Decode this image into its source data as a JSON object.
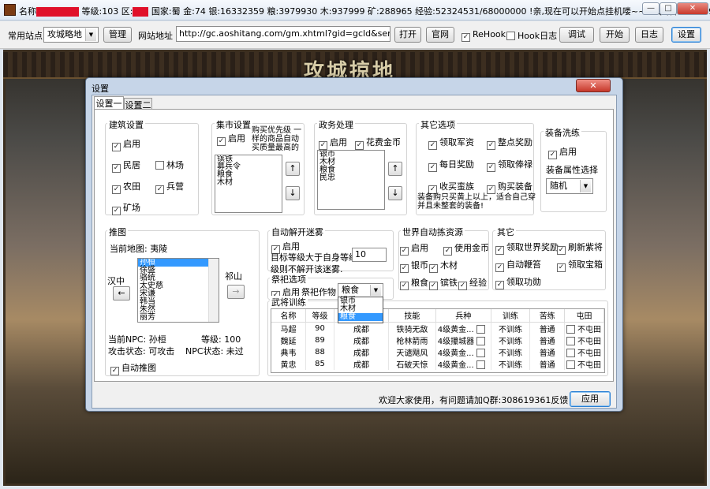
{
  "window": {
    "name_label": "名称",
    "level": "等级:103",
    "zone_label": "区:",
    "country": "国家:蜀",
    "gold": "金:74",
    "silver": "银:16332359",
    "food": "粮:3979930",
    "wood": "木:937999",
    "ore": "矿:288965",
    "exp": "经验:52324531/68000000",
    "message": "!亲,现在可以开始点挂机喽~~~",
    "qq": "QQ群:308619361",
    "min": "—",
    "max": "□",
    "close": "✕"
  },
  "toolbar": {
    "site_label": "常用站点",
    "site_value": "攻城略地",
    "manage": "管理",
    "url_label": "网站地址",
    "url": "http://gc.aoshitang.com/gm.xhtml?gid=gcld&server=113",
    "open": "打开",
    "official": "官网",
    "rehook": "ReHook",
    "hooklog": "Hook日志",
    "debug": "调试",
    "start": "开始",
    "log": "日志",
    "settings": "设置"
  },
  "game": {
    "title": "攻城掠地"
  },
  "dialog": {
    "title": "设置",
    "close": "✕",
    "tabs": [
      "设置一",
      "设置二"
    ],
    "build": {
      "title": "建筑设置",
      "enable": "启用",
      "items": [
        "民居",
        "林场",
        "农田",
        "兵营",
        "矿场"
      ]
    },
    "market": {
      "title": "集市设置",
      "enable": "启用",
      "hint1": "购买优先级 一",
      "hint2": "样的商品自动",
      "hint3": "买质量最高的",
      "items": [
        "镔铁",
        "募兵令",
        "粮食",
        "木材"
      ],
      "up": "↑",
      "down": "↓"
    },
    "affairs": {
      "title": "政务处理",
      "enable": "启用",
      "spend": "花费金币",
      "items": [
        "银币",
        "木材",
        "粮食",
        "民忠"
      ],
      "up": "↑",
      "down": "↓"
    },
    "other": {
      "title": "其它选项",
      "items": [
        "领取军资",
        "整点奖励",
        "每日奖励",
        "领取俸禄",
        "收买蛮族",
        "购买装备"
      ],
      "note1": "装备购只买黄上以上，适合自己穿",
      "note2": "并且未整套的装备!"
    },
    "equip": {
      "title": "装备洗练",
      "enable": "启用",
      "attr_label": "装备属性选择",
      "attr_value": "随机"
    },
    "push": {
      "title": "推图",
      "current_map": "当前地图: 夷陵",
      "left": "汉中",
      "right": "祁山",
      "prev": "←",
      "next": "→",
      "npcs": [
        "孙桓",
        "徐盛",
        "骆统",
        "太史慈",
        "宋谦",
        "韩当",
        "朱然",
        "丽芳"
      ],
      "npc_label": "当前NPC:",
      "npc_value": "孙桓",
      "lvl_label": "等级:",
      "lvl_value": "100",
      "atk_label": "攻击状态:",
      "atk_value": "可攻击",
      "npcst_label": "NPC状态:",
      "npcst_value": "未过",
      "auto": "自动推图"
    },
    "fog": {
      "title": "自动解开迷雾",
      "enable": "启用",
      "target_label": "目标等级大于自身等级",
      "target_value": "10",
      "hint": "级则不解开该迷雾."
    },
    "sacrifice": {
      "title": "祭祀选项",
      "enable": "启用",
      "crop_label": "祭祀作物",
      "crop_value": "粮食",
      "options": [
        "银币",
        "木材",
        "粮食"
      ]
    },
    "world": {
      "title": "世界自动拣资源",
      "items": [
        "启用",
        "使用金币",
        "银币",
        "木材",
        "粮食",
        "镔铁",
        "经验"
      ]
    },
    "misc": {
      "title": "其它",
      "items": [
        "领取世界奖励",
        "刷新紫将",
        "自动鞭笞",
        "领取宝箱",
        "领取功勋"
      ]
    },
    "generals": {
      "title": "武将训练",
      "headers": [
        "名称",
        "等级",
        "",
        "技能",
        "兵种",
        "训练",
        "苦练",
        "屯田"
      ],
      "rows": [
        {
          "name": "马超",
          "level": "90",
          "city": "成都",
          "skill": "铁骑无敌",
          "troop": "4级黄金...",
          "train": "不训练",
          "hard": "普通",
          "farm": "不屯田"
        },
        {
          "name": "魏延",
          "level": "89",
          "city": "成都",
          "skill": "枪林箭雨",
          "troop": "4级攥城器",
          "train": "不训练",
          "hard": "普通",
          "farm": "不屯田"
        },
        {
          "name": "典韦",
          "level": "88",
          "city": "成都",
          "skill": "天谴飓风",
          "troop": "4级黄金...",
          "train": "不训练",
          "hard": "普通",
          "farm": "不屯田"
        },
        {
          "name": "黄忠",
          "level": "85",
          "city": "成都",
          "skill": "石破天惊",
          "troop": "4级黄金...",
          "train": "不训练",
          "hard": "普通",
          "farm": "不屯田"
        }
      ]
    },
    "footer": "欢迎大家使用，有问题请加Q群:308619361反馈!",
    "apply": "应用"
  }
}
